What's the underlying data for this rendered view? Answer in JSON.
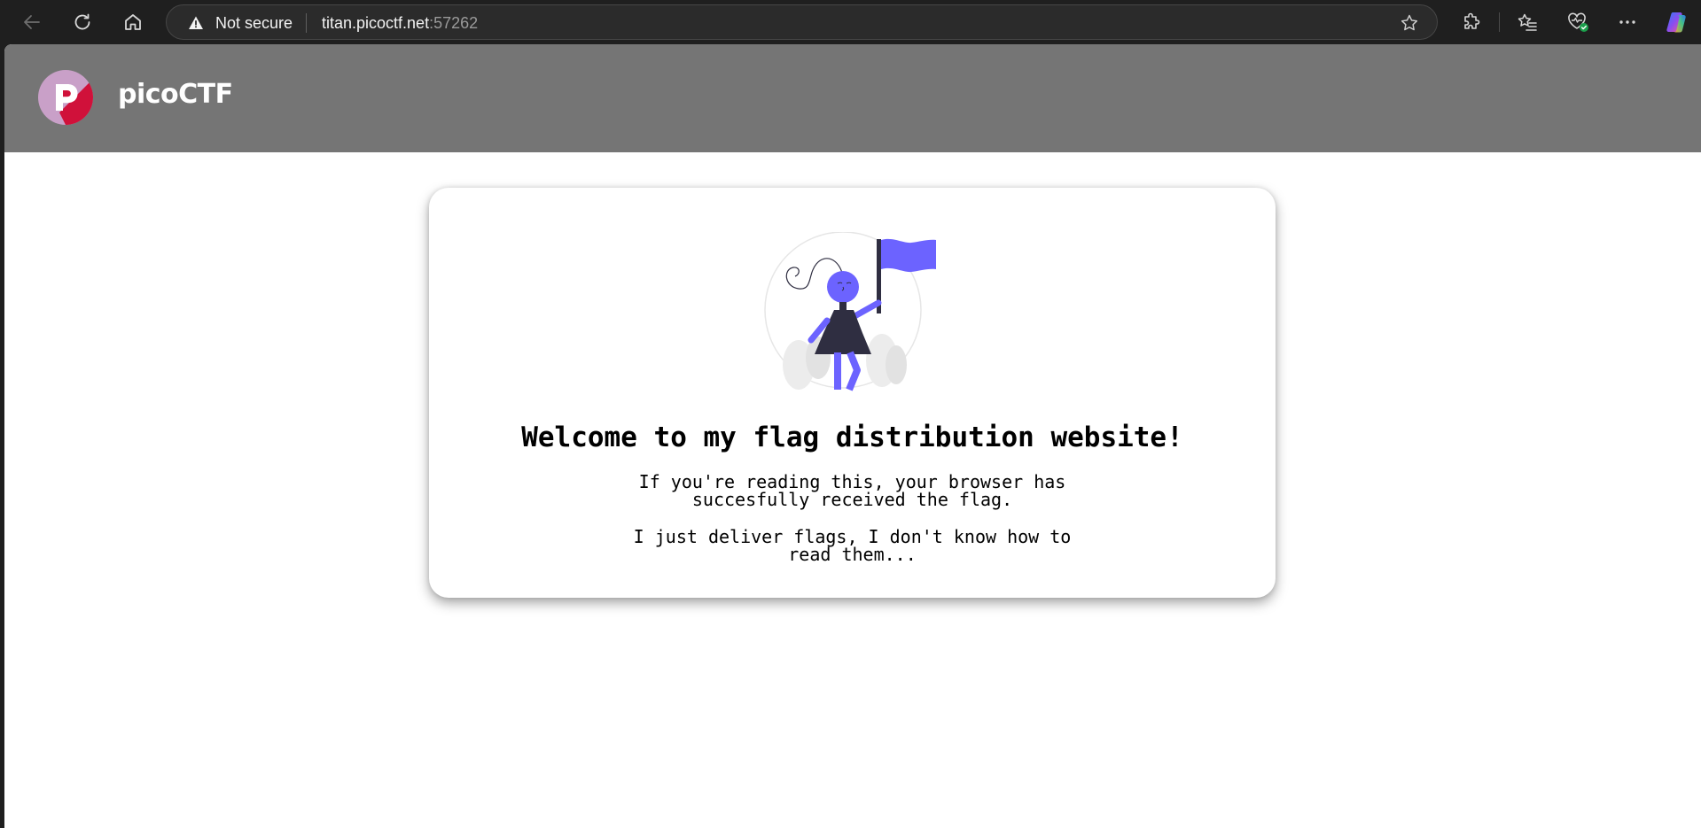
{
  "browser": {
    "security_label": "Not secure",
    "url_host": "titan.picoctf.net",
    "url_port": ":57262",
    "icons": {
      "back": "back-arrow-icon",
      "reload": "reload-icon",
      "home": "home-icon",
      "warning": "warning-icon",
      "favorite": "star-icon",
      "extensions": "puzzle-icon",
      "favorites": "favorites-list-icon",
      "health": "heart-check-icon",
      "more": "more-dots-icon",
      "copilot": "copilot-icon"
    }
  },
  "site": {
    "logo_text": "picoCTF",
    "brand_colors": {
      "header": "#757575",
      "logo_pink": "#c9a0c8",
      "logo_red": "#d0113a",
      "accent": "#6c63ff"
    }
  },
  "card": {
    "title": "Welcome to my flag distribution website!",
    "paragraph1_line1": "If you're reading this, your browser has",
    "paragraph1_line2": "succesfully received the flag.",
    "paragraph2_line1": "I just deliver flags, I don't know how to",
    "paragraph2_line2": "read them..."
  }
}
